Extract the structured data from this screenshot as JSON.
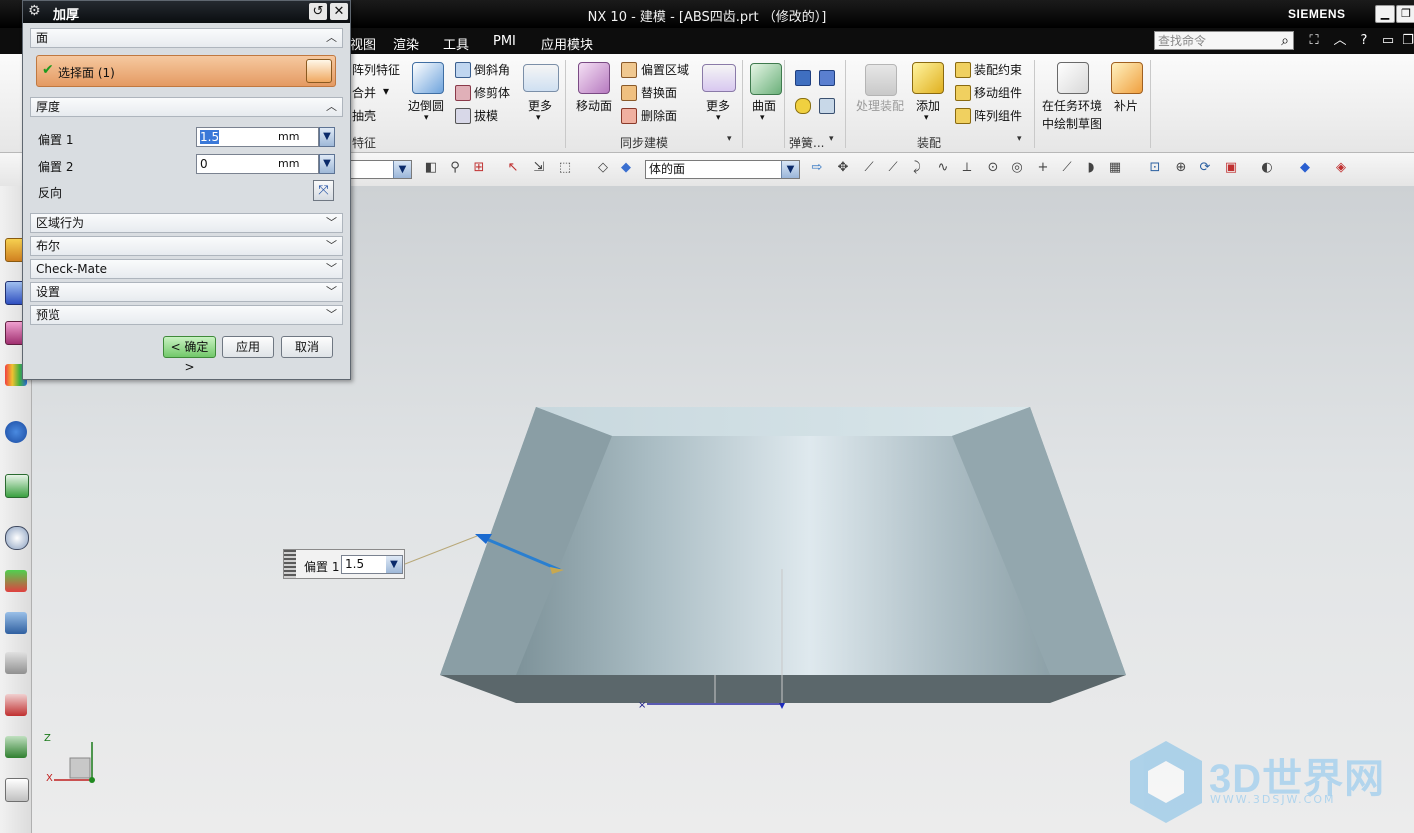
{
  "app": {
    "window_title": "NX 10 - 建模 - [ABS四齿.prt （修改的）]",
    "brand": "SIEMENS"
  },
  "menu": {
    "items": [
      "视图",
      "渲染",
      "工具",
      "PMI",
      "应用模块"
    ],
    "search_placeholder": "查找命令"
  },
  "ribbon": {
    "partial_group": {
      "items": [
        "阵列特征",
        "合并",
        "抽壳"
      ],
      "title": "特征"
    },
    "feature_tools": {
      "big": "边倒圆",
      "small": [
        "倒斜角",
        "修剪体",
        "拔模"
      ],
      "more": "更多"
    },
    "sync": {
      "big": "移动面",
      "small": [
        "偏置区域",
        "替换面",
        "删除面"
      ],
      "more": "更多",
      "title": "同步建模"
    },
    "surface": {
      "big": "曲面"
    },
    "spring": {
      "title": "弹簧..."
    },
    "assembly": {
      "disabled": "处理装配",
      "add": "添加",
      "small": [
        "装配约束",
        "移动组件",
        "阵列组件"
      ],
      "title": "装配"
    },
    "sketch": {
      "line1": "在任务环境",
      "line2": "中绘制草图"
    },
    "patch": "补片"
  },
  "toolbar": {
    "face_filter": "体的面"
  },
  "dialog": {
    "title": "加厚",
    "face_section": "面",
    "select_face": "选择面 (1)",
    "thickness_section": "厚度",
    "offset1_label": "偏置 1",
    "offset1_value": "1.5",
    "offset1_unit": "mm",
    "offset2_label": "偏置 2",
    "offset2_value": "0",
    "offset2_unit": "mm",
    "reverse_label": "反向",
    "collapsed_sections": [
      "区域行为",
      "布尔",
      "Check-Mate",
      "设置",
      "预览"
    ],
    "ok": "< 确定 >",
    "apply": "应用",
    "cancel": "取消"
  },
  "onscreen": {
    "label": "偏置 1",
    "value": "1.5"
  },
  "triad": {
    "x": "X",
    "z": "Z"
  },
  "watermark": {
    "title": "3D世界网",
    "url": "WWW.3DSJW.COM"
  },
  "colors": {
    "selection_orange": "#e8a06a",
    "ok_green": "#7ed37a",
    "model_grey": "#8fa1a8",
    "title_bar": "#0f1012"
  }
}
